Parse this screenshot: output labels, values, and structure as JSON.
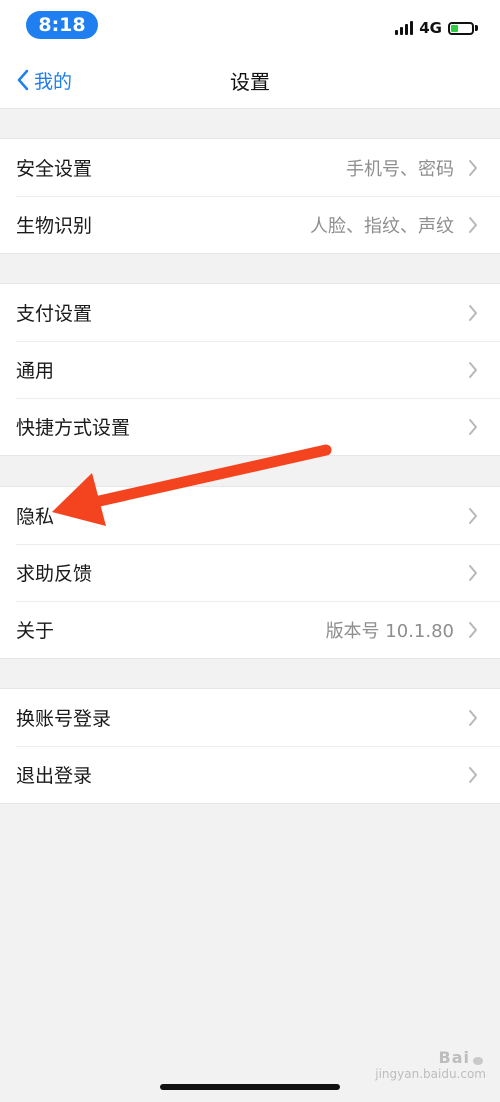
{
  "status_bar": {
    "time": "8:18",
    "network": "4G",
    "accent_color": "#1f7ff0",
    "battery_color": "#2ecc40"
  },
  "nav": {
    "back_label": "我的",
    "title": "设置"
  },
  "groups": [
    {
      "rows": [
        {
          "label": "安全设置",
          "value": "手机号、密码"
        },
        {
          "label": "生物识别",
          "value": "人脸、指纹、声纹"
        }
      ]
    },
    {
      "rows": [
        {
          "label": "支付设置",
          "value": ""
        },
        {
          "label": "通用",
          "value": ""
        },
        {
          "label": "快捷方式设置",
          "value": ""
        }
      ]
    },
    {
      "rows": [
        {
          "label": "隐私",
          "value": ""
        },
        {
          "label": "求助反馈",
          "value": ""
        },
        {
          "label": "关于",
          "value": "版本号 10.1.80"
        }
      ]
    },
    {
      "rows": [
        {
          "label": "换账号登录",
          "value": ""
        },
        {
          "label": "退出登录",
          "value": ""
        }
      ]
    }
  ],
  "annotation": {
    "color": "#f4431f"
  },
  "watermark": {
    "brand": "Bai",
    "sub": "jingyan.baidu.com"
  }
}
